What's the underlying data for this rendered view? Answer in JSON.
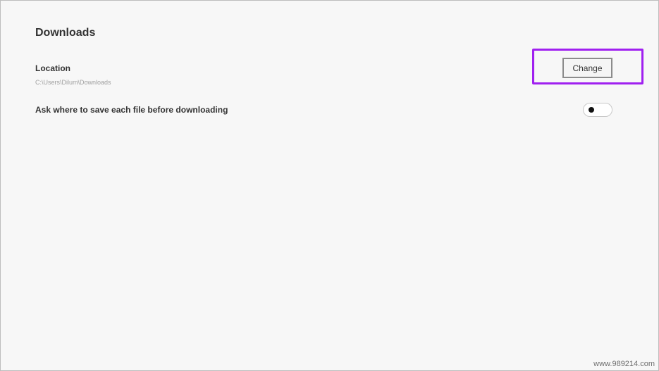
{
  "downloads": {
    "title": "Downloads",
    "location": {
      "label": "Location",
      "path": "C:\\Users\\Dilum\\Downloads",
      "change_label": "Change"
    },
    "ask_before_download": {
      "label": "Ask where to save each file before downloading",
      "enabled": false
    }
  },
  "colors": {
    "highlight": "#a020f0",
    "background": "#f7f7f7"
  },
  "watermark": "www.989214.com"
}
